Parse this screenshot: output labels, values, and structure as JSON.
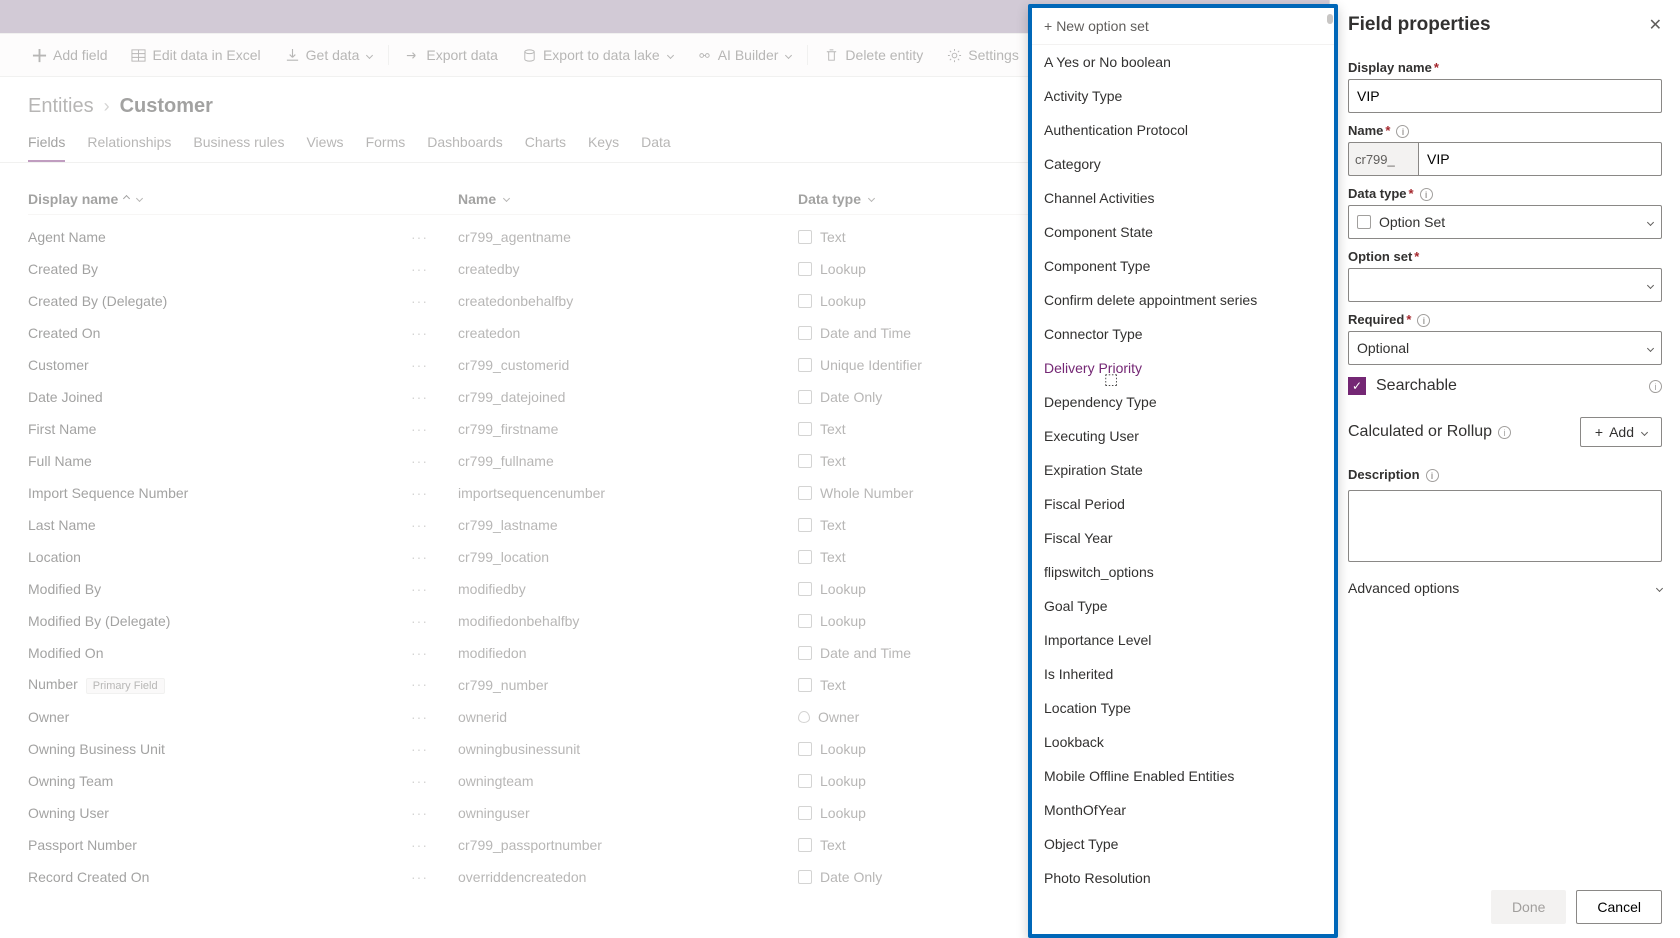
{
  "commandbar": {
    "add_field": "Add field",
    "edit_excel": "Edit data in Excel",
    "get_data": "Get data",
    "export_data": "Export data",
    "export_data_lake": "Export to data lake",
    "ai_builder": "AI Builder",
    "delete_entity": "Delete entity",
    "settings": "Settings"
  },
  "breadcrumb": {
    "level1": "Entities",
    "level2": "Customer"
  },
  "tabs": {
    "fields": "Fields",
    "relationships": "Relationships",
    "business_rules": "Business rules",
    "views": "Views",
    "forms": "Forms",
    "dashboards": "Dashboards",
    "charts": "Charts",
    "keys": "Keys",
    "data": "Data"
  },
  "columns": {
    "display_name": "Display name",
    "name": "Name",
    "data_type": "Data type"
  },
  "primary_badge": "Primary Field",
  "rows": [
    {
      "dn": "Agent Name",
      "n": "cr799_agentname",
      "dt": "Text"
    },
    {
      "dn": "Created By",
      "n": "createdby",
      "dt": "Lookup"
    },
    {
      "dn": "Created By (Delegate)",
      "n": "createdonbehalfby",
      "dt": "Lookup"
    },
    {
      "dn": "Created On",
      "n": "createdon",
      "dt": "Date and Time"
    },
    {
      "dn": "Customer",
      "n": "cr799_customerid",
      "dt": "Unique Identifier"
    },
    {
      "dn": "Date Joined",
      "n": "cr799_datejoined",
      "dt": "Date Only"
    },
    {
      "dn": "First Name",
      "n": "cr799_firstname",
      "dt": "Text"
    },
    {
      "dn": "Full Name",
      "n": "cr799_fullname",
      "dt": "Text"
    },
    {
      "dn": "Import Sequence Number",
      "n": "importsequencenumber",
      "dt": "Whole Number"
    },
    {
      "dn": "Last Name",
      "n": "cr799_lastname",
      "dt": "Text"
    },
    {
      "dn": "Location",
      "n": "cr799_location",
      "dt": "Text"
    },
    {
      "dn": "Modified By",
      "n": "modifiedby",
      "dt": "Lookup"
    },
    {
      "dn": "Modified By (Delegate)",
      "n": "modifiedonbehalfby",
      "dt": "Lookup"
    },
    {
      "dn": "Modified On",
      "n": "modifiedon",
      "dt": "Date and Time"
    },
    {
      "dn": "Number",
      "n": "cr799_number",
      "dt": "Text",
      "primary": true
    },
    {
      "dn": "Owner",
      "n": "ownerid",
      "dt": "Owner"
    },
    {
      "dn": "Owning Business Unit",
      "n": "owningbusinessunit",
      "dt": "Lookup"
    },
    {
      "dn": "Owning Team",
      "n": "owningteam",
      "dt": "Lookup"
    },
    {
      "dn": "Owning User",
      "n": "owninguser",
      "dt": "Lookup"
    },
    {
      "dn": "Passport Number",
      "n": "cr799_passportnumber",
      "dt": "Text"
    },
    {
      "dn": "Record Created On",
      "n": "overriddencreatedon",
      "dt": "Date Only"
    }
  ],
  "dropdown": {
    "new_option": "New option set",
    "hover_item": "Delivery Priority",
    "items": [
      "A Yes or No boolean",
      "Activity Type",
      "Authentication Protocol",
      "Category",
      "Channel Activities",
      "Component State",
      "Component Type",
      "Confirm delete appointment series",
      "Connector Type",
      "Delivery Priority",
      "Dependency Type",
      "Executing User",
      "Expiration State",
      "Fiscal Period",
      "Fiscal Year",
      "flipswitch_options",
      "Goal Type",
      "Importance Level",
      "Is Inherited",
      "Location Type",
      "Lookback",
      "Mobile Offline Enabled Entities",
      "MonthOfYear",
      "Object Type",
      "Photo Resolution"
    ]
  },
  "panel": {
    "title": "Field properties",
    "display_name_label": "Display name",
    "display_name_value": "VIP",
    "name_label": "Name",
    "name_prefix": "cr799_",
    "name_value": "VIP",
    "data_type_label": "Data type",
    "data_type_value": "Option Set",
    "option_set_label": "Option set",
    "option_set_value": "",
    "required_label": "Required",
    "required_value": "Optional",
    "searchable_label": "Searchable",
    "calc_label": "Calculated or Rollup",
    "add_label": "Add",
    "description_label": "Description",
    "description_value": "",
    "advanced_label": "Advanced options",
    "done": "Done",
    "cancel": "Cancel"
  }
}
